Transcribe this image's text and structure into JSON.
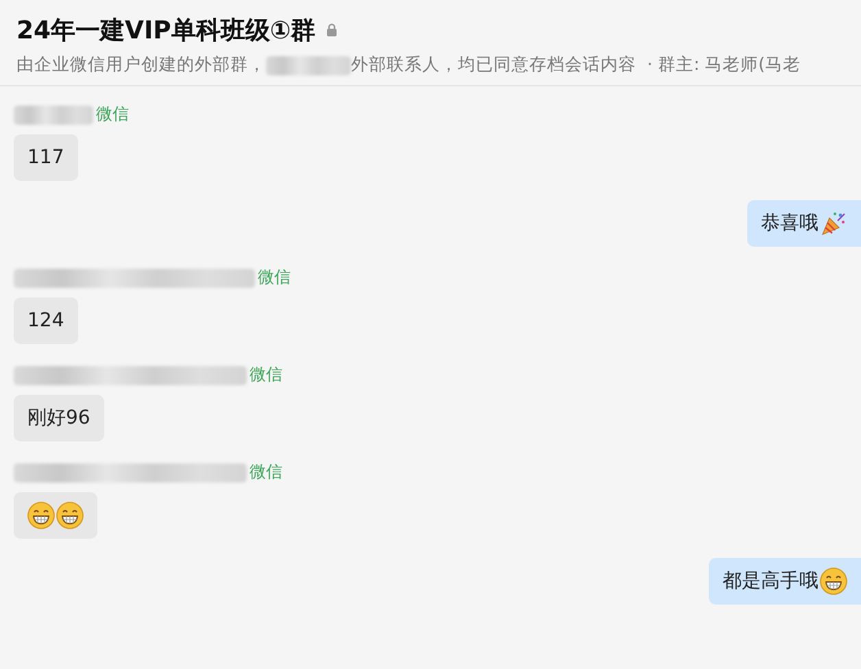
{
  "header": {
    "title": "24年一建VIP单科班级①群",
    "subtitle_parts": [
      "由企业微信用户创建的外部群，",
      "外部联系人，均已同意存档会话内容",
      "· 群主: 马老师(马老"
    ]
  },
  "messages": [
    {
      "kind": "incoming",
      "sender_tag": "微信",
      "text": "117"
    },
    {
      "kind": "outgoing",
      "text": "恭喜哦",
      "emojis": [
        {
          "kind": "party"
        }
      ]
    },
    {
      "kind": "incoming",
      "sender_tag": "微信",
      "text": "124"
    },
    {
      "kind": "incoming",
      "sender_tag": "微信",
      "text": "刚好96"
    },
    {
      "kind": "incoming",
      "sender_tag": "微信",
      "emojis": [
        {
          "kind": "grin"
        },
        {
          "kind": "grin"
        }
      ]
    },
    {
      "kind": "outgoing",
      "text": "都是高手哦",
      "emojis": [
        {
          "kind": "grin"
        }
      ]
    }
  ]
}
